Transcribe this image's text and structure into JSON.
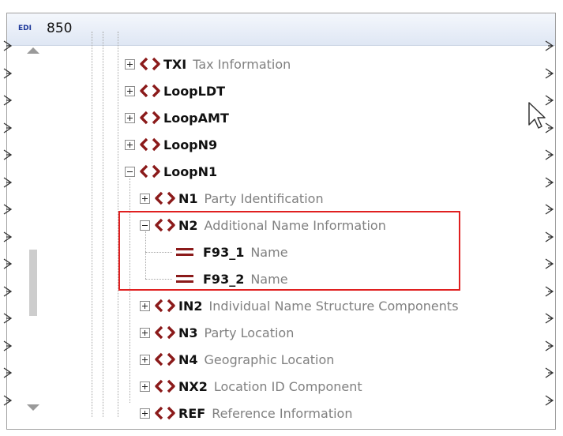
{
  "window": {
    "icon": "edi-icon",
    "icon_label": "EDI",
    "title": "850"
  },
  "tree": [
    {
      "name": "TXI",
      "desc": "Tax Information",
      "kind": "segment",
      "expander": "plus"
    },
    {
      "name": "LoopLDT",
      "desc": "",
      "kind": "segment",
      "expander": "plus"
    },
    {
      "name": "LoopAMT",
      "desc": "",
      "kind": "segment",
      "expander": "plus"
    },
    {
      "name": "LoopN9",
      "desc": "",
      "kind": "segment",
      "expander": "plus"
    },
    {
      "name": "LoopN1",
      "desc": "",
      "kind": "segment",
      "expander": "minus"
    },
    {
      "name": "N1",
      "desc": "Party Identification",
      "kind": "segment",
      "expander": "plus"
    },
    {
      "name": "N2",
      "desc": "Additional Name Information",
      "kind": "segment",
      "expander": "minus"
    },
    {
      "name": "F93_1",
      "desc": "Name",
      "kind": "field"
    },
    {
      "name": "F93_2",
      "desc": "Name",
      "kind": "field"
    },
    {
      "name": "IN2",
      "desc": "Individual Name Structure Components",
      "kind": "segment",
      "expander": "plus"
    },
    {
      "name": "N3",
      "desc": "Party Location",
      "kind": "segment",
      "expander": "plus"
    },
    {
      "name": "N4",
      "desc": "Geographic Location",
      "kind": "segment",
      "expander": "plus"
    },
    {
      "name": "NX2",
      "desc": "Location ID Component",
      "kind": "segment",
      "expander": "plus"
    },
    {
      "name": "REF",
      "desc": "Reference Information",
      "kind": "segment",
      "expander": "plus"
    }
  ],
  "colors": {
    "segment_icon": "#8b1a1a",
    "highlight": "#e02020",
    "description": "#808080"
  }
}
